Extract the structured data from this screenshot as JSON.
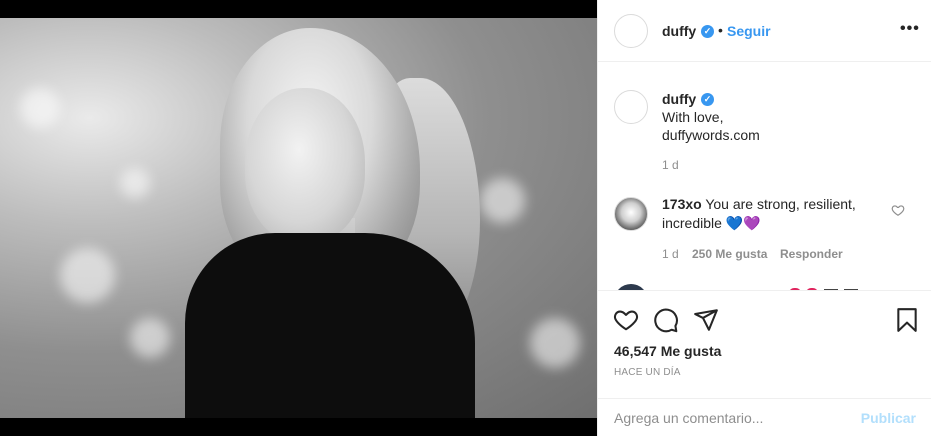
{
  "post": {
    "username": "duffy",
    "follow_label": "Seguir",
    "more_label": "•••"
  },
  "caption": {
    "username": "duffy",
    "lines": [
      "With love,",
      "duffywords.com"
    ],
    "age": "1 d"
  },
  "comments": [
    {
      "username": "173xo",
      "text_line1": "You are strong, resilient,",
      "text_line2": "incredible 💙💜",
      "age": "1 d",
      "likes": "250 Me gusta",
      "reply_label": "Responder"
    }
  ],
  "actions": {
    "likes_count": "46,547 Me gusta",
    "timestamp": "HACE UN DÍA"
  },
  "comment_box": {
    "placeholder": "Agrega un comentario...",
    "publish_label": "Publicar"
  },
  "colors": {
    "accent": "#3897f0",
    "publish_disabled": "#b2dffc",
    "secondary_text": "#8e8e8e"
  },
  "icons": [
    "verified-icon",
    "more-options-icon",
    "heart-icon",
    "comment-icon",
    "share-icon",
    "bookmark-icon"
  ]
}
